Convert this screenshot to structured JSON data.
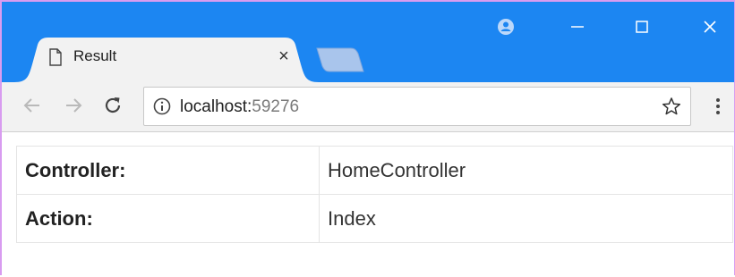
{
  "window": {
    "accent_color": "#1c86f2",
    "controls": {
      "profile_icon": "profile-icon",
      "minimize_icon": "minimize-icon",
      "maximize_icon": "maximize-icon",
      "close_icon": "close-icon"
    }
  },
  "tab": {
    "title": "Result",
    "icon": "document-icon",
    "close_symbol": "×"
  },
  "toolbar": {
    "back_icon": "arrow-left-icon",
    "forward_icon": "arrow-right-icon",
    "reload_icon": "reload-icon",
    "url_host": "localhost:",
    "url_port": "59276",
    "site_info_icon": "info-icon",
    "bookmark_icon": "star-icon",
    "menu_icon": "kebab-menu-icon"
  },
  "table": {
    "rows": [
      {
        "label": "Controller:",
        "value": "HomeController"
      },
      {
        "label": "Action:",
        "value": "Index"
      }
    ]
  }
}
